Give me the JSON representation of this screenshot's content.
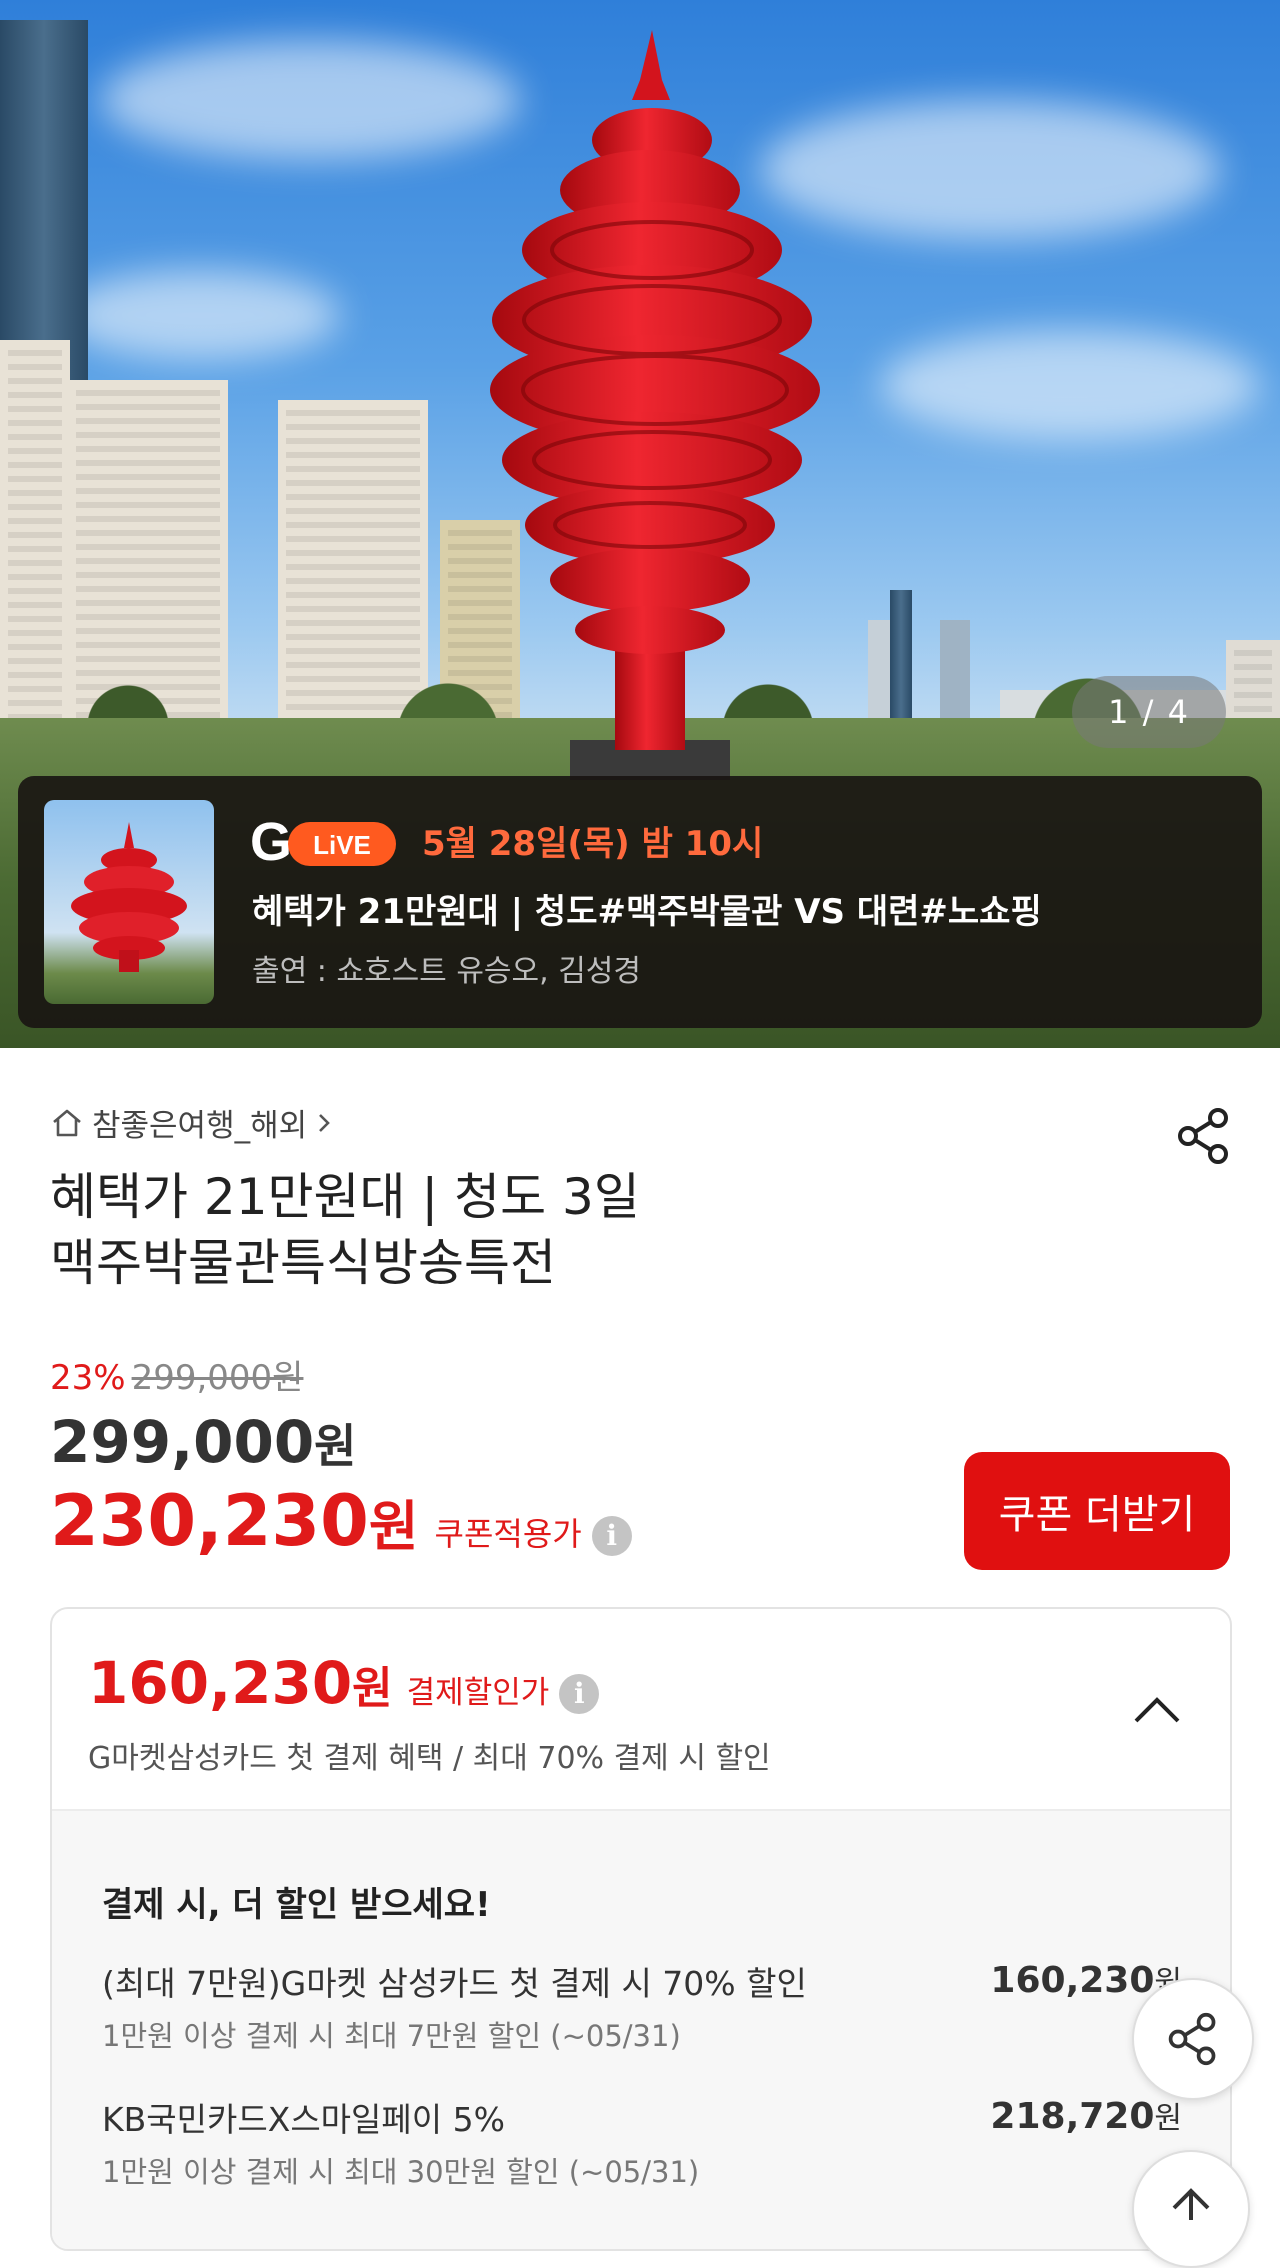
{
  "hero": {
    "pager": "1 / 4",
    "live": {
      "brand": "LiVE",
      "date": "5월 28일(목) 밤 10시",
      "title": "혜택가 21만원대 | 청도#맥주박물관 VS 대련#노쇼핑",
      "cast": "출연 : 쇼호스트 유승오, 김성경"
    }
  },
  "product": {
    "seller": "참좋은여행_해외",
    "title_line1": "혜택가 21만원대 | 청도 3일",
    "title_line2": "맥주박물관특식방송특전",
    "discount_rate": "23%",
    "original_price": "299,000원",
    "price_number": "299,000",
    "price_unit": "원",
    "coupon_price_number": "230,230",
    "coupon_price_unit": "원",
    "coupon_price_label": "쿠폰적용가",
    "coupon_button": "쿠폰 더받기"
  },
  "payment": {
    "price_number": "160,230",
    "price_unit": "원",
    "price_label": "결제할인가",
    "subtitle": "G마켓삼성카드 첫 결제 혜택 / 최대 70% 결제 시 할인",
    "section_title": "결제 시, 더 할인 받으세요!",
    "offers": [
      {
        "name": "(최대 7만원)G마켓 삼성카드 첫 결제 시 70% 할인",
        "desc": "1만원 이상 결제 시 최대 7만원 할인 (~05/31)",
        "amount": "160,230",
        "unit": "원"
      },
      {
        "name": "KB국민카드X스마일페이 5%",
        "desc": "1만원 이상 결제 시 최대 30만원 할인 (~05/31)",
        "amount": "218,720",
        "unit": "원"
      }
    ]
  },
  "icons": {
    "seller_home": "home-icon",
    "share": "share-icon",
    "info": "info-icon",
    "collapse": "chevron-up-icon",
    "scroll_top": "arrow-up-icon"
  },
  "colors": {
    "accent_red": "#e01a1a",
    "live_orange": "#ff6a3d",
    "banner_bg": "#181412"
  }
}
